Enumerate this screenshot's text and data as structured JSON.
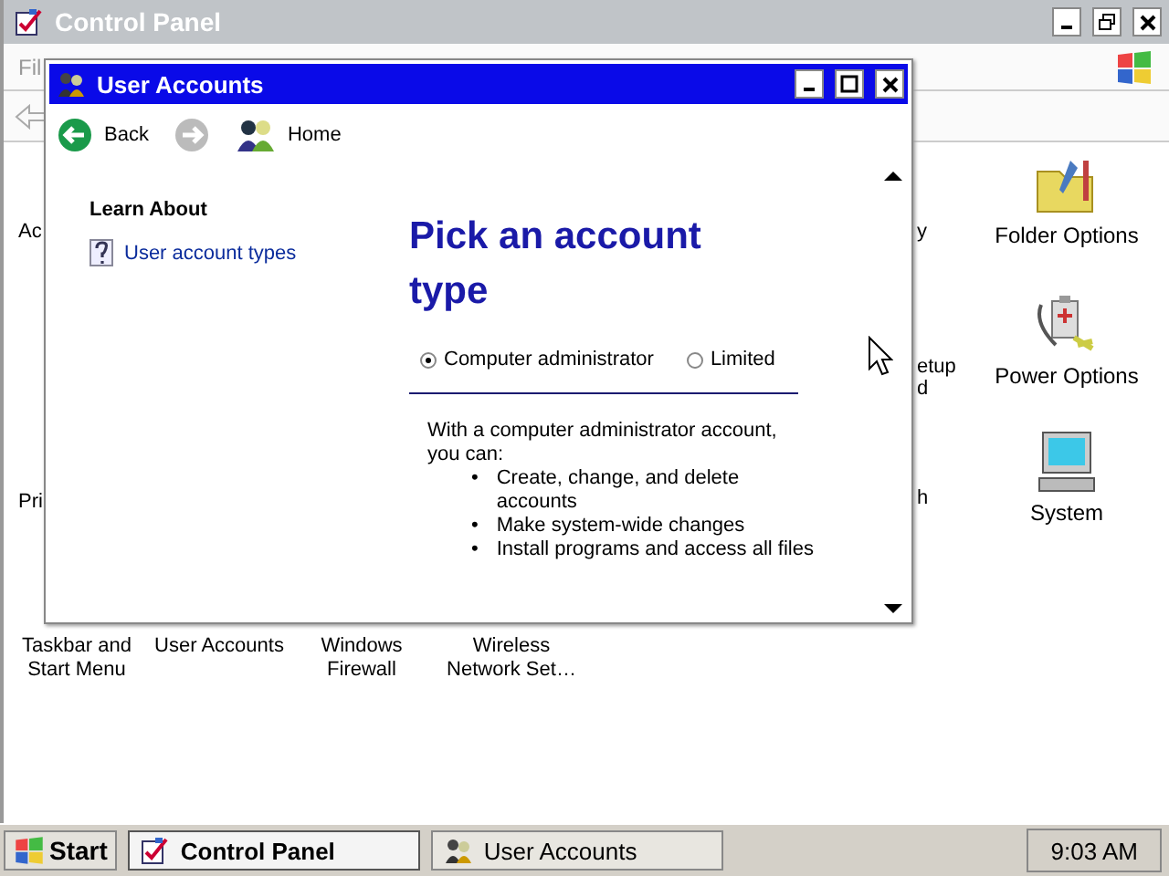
{
  "control_panel": {
    "title": "Control Panel",
    "menu": [
      "Fil"
    ],
    "left_fragments": [
      "Ac",
      "Pri"
    ],
    "right_fragments": [
      {
        "text": "y"
      },
      {
        "text": "etup"
      },
      {
        "text": "d"
      },
      {
        "text": "h"
      }
    ],
    "icons": [
      {
        "label": "Folder Options",
        "kind": "folder"
      },
      {
        "label": "Power Options",
        "kind": "power"
      },
      {
        "label": "System",
        "kind": "system"
      }
    ],
    "bottom_items": [
      {
        "lines": [
          "Taskbar and",
          "Start Menu"
        ]
      },
      {
        "lines": [
          "User Accounts"
        ]
      },
      {
        "lines": [
          "Windows",
          "Firewall"
        ]
      },
      {
        "lines": [
          "Wireless",
          "Network Set…"
        ]
      }
    ]
  },
  "dialog": {
    "title": "User Accounts",
    "nav": [
      {
        "kind": "back",
        "label": "Back",
        "disabled": false
      },
      {
        "kind": "forward",
        "disabled": true
      },
      {
        "kind": "home",
        "label": "Home",
        "disabled": false
      }
    ],
    "learn_about": {
      "heading": "Learn About",
      "links": [
        "User account types"
      ]
    },
    "heading": "Pick an account type",
    "radios": [
      {
        "label": "Computer administrator",
        "selected": true
      },
      {
        "label": "Limited",
        "selected": false
      }
    ],
    "description": "With a computer administrator account, you can:",
    "bullets": [
      {
        "marker": "•",
        "text": "Create, change, and delete accounts"
      },
      {
        "marker": "•",
        "text": "Make system-wide changes"
      },
      {
        "marker": "•",
        "text": "Install programs and access all files"
      }
    ]
  },
  "taskbar": {
    "start": "Start",
    "tasks": [
      {
        "label": "Control Panel",
        "kind": "control-panel",
        "selected": true
      },
      {
        "label": "User Accounts",
        "kind": "users",
        "selected": false
      }
    ],
    "clock": "9:03 AM"
  }
}
